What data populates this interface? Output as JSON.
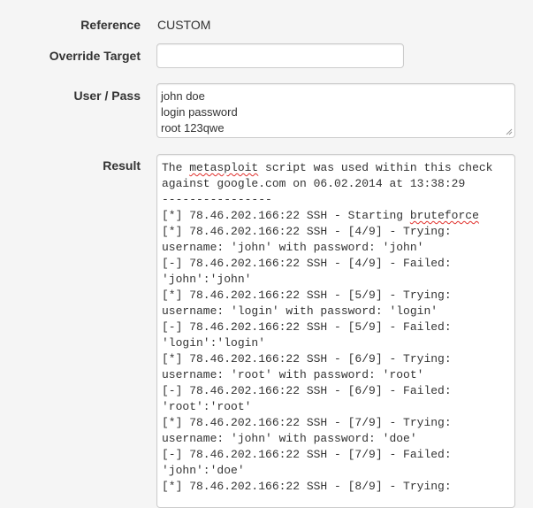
{
  "form": {
    "reference": {
      "label": "Reference",
      "value": "CUSTOM"
    },
    "override_target": {
      "label": "Override Target",
      "value": "",
      "placeholder": ""
    },
    "user_pass": {
      "label": "User / Pass",
      "lines": [
        "john doe",
        "login password",
        "root 123qwe"
      ]
    },
    "result": {
      "label": "Result",
      "lines": [
        "The metasploit script was used within this check",
        "against google.com on 06.02.2014 at 13:38:29",
        "----------------",
        "[*] 78.46.202.166:22 SSH - Starting bruteforce",
        "[*] 78.46.202.166:22 SSH - [4/9] - Trying:",
        "username: 'john' with password: 'john'",
        "[-] 78.46.202.166:22 SSH - [4/9] - Failed:",
        "'john':'john'",
        "[*] 78.46.202.166:22 SSH - [5/9] - Trying:",
        "username: 'login' with password: 'login'",
        "[-] 78.46.202.166:22 SSH - [5/9] - Failed:",
        "'login':'login'",
        "[*] 78.46.202.166:22 SSH - [6/9] - Trying:",
        "username: 'root' with password: 'root'",
        "[-] 78.46.202.166:22 SSH - [6/9] - Failed:",
        "'root':'root'",
        "[*] 78.46.202.166:22 SSH - [7/9] - Trying:",
        "username: 'john' with password: 'doe'",
        "[-] 78.46.202.166:22 SSH - [7/9] - Failed:",
        "'john':'doe'",
        "[*] 78.46.202.166:22 SSH - [8/9] - Trying:"
      ]
    }
  }
}
